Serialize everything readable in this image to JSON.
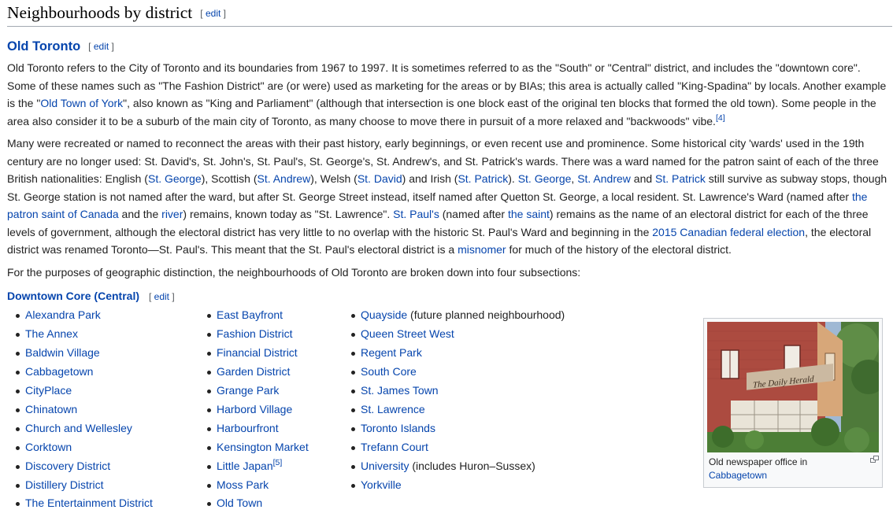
{
  "section": {
    "title": "Neighbourhoods by district",
    "edit_label": "edit"
  },
  "subsection": {
    "title": "Old Toronto",
    "edit_label": "edit"
  },
  "paragraphs": {
    "p1": [
      {
        "t": "Old Toronto refers to the City of Toronto and its boundaries from 1967 to 1997. It is sometimes referred to as the \"South\" or \"Central\" district, and includes the \"downtown core\". Some of these names such as \"The Fashion District\" are (or were) used as marketing for the areas or by BIAs; this area is actually called \"King-Spadina\" by locals. Another example is the \""
      },
      {
        "t": "Old Town of York",
        "link": true
      },
      {
        "t": "\", also known as \"King and Parliament\" (although that intersection is one block east of the original ten blocks that formed the old town). Some people in the area also consider it to be a suburb of the main city of Toronto, as many choose to move there in pursuit of a more relaxed and \"backwoods\" vibe."
      },
      {
        "t": "[4]",
        "link": true,
        "sup": true
      }
    ],
    "p2": [
      {
        "t": "Many were recreated or named to reconnect the areas with their past history, early beginnings, or even recent use and prominence. Some historical city 'wards' used in the 19th century are no longer used: St. David's, St. John's, St. Paul's, St. George's, St. Andrew's, and St. Patrick's wards. There was a ward named for the patron saint of each of the three British nationalities: English ("
      },
      {
        "t": "St. George",
        "link": true
      },
      {
        "t": "), Scottish ("
      },
      {
        "t": "St. Andrew",
        "link": true
      },
      {
        "t": "), Welsh ("
      },
      {
        "t": "St. David",
        "link": true
      },
      {
        "t": ") and Irish ("
      },
      {
        "t": "St. Patrick",
        "link": true
      },
      {
        "t": "). "
      },
      {
        "t": "St. George",
        "link": true
      },
      {
        "t": ", "
      },
      {
        "t": "St. Andrew",
        "link": true
      },
      {
        "t": " and "
      },
      {
        "t": "St. Patrick",
        "link": true
      },
      {
        "t": " still survive as subway stops, though St. George station is not named after the ward, but after St. George Street instead, itself named after Quetton St. George, a local resident. St. Lawrence's Ward (named after "
      },
      {
        "t": "the patron saint of Canada",
        "link": true
      },
      {
        "t": " and the "
      },
      {
        "t": "river",
        "link": true
      },
      {
        "t": ") remains, known today as \"St. Lawrence\". "
      },
      {
        "t": "St. Paul's",
        "link": true
      },
      {
        "t": " (named after "
      },
      {
        "t": "the saint",
        "link": true
      },
      {
        "t": ") remains as the name of an electoral district for each of the three levels of government, although the electoral district has very little to no overlap with the historic St. Paul's Ward and beginning in the "
      },
      {
        "t": "2015 Canadian federal election",
        "link": true
      },
      {
        "t": ", the electoral district was renamed Toronto—St. Paul's. This meant that the St. Paul's electoral district is a "
      },
      {
        "t": "misnomer",
        "link": true
      },
      {
        "t": " for much of the history of the electoral district."
      }
    ],
    "p3": [
      {
        "t": "For the purposes of geographic distinction, the neighbourhoods of Old Toronto are broken down into four subsections:"
      }
    ]
  },
  "subsubsection": {
    "title": "Downtown Core (Central)",
    "edit_label": "edit"
  },
  "columns": {
    "col1": [
      {
        "label": "Alexandra Park"
      },
      {
        "label": "The Annex"
      },
      {
        "label": "Baldwin Village"
      },
      {
        "label": "Cabbagetown"
      },
      {
        "label": "CityPlace"
      },
      {
        "label": "Chinatown"
      },
      {
        "label": "Church and Wellesley"
      },
      {
        "label": "Corktown"
      },
      {
        "label": "Discovery District"
      },
      {
        "label": "Distillery District"
      },
      {
        "label": "The Entertainment District"
      }
    ],
    "col2": [
      {
        "label": "East Bayfront"
      },
      {
        "label": "Fashion District"
      },
      {
        "label": "Financial District"
      },
      {
        "label": "Garden District"
      },
      {
        "label": "Grange Park"
      },
      {
        "label": "Harbord Village"
      },
      {
        "label": "Harbourfront"
      },
      {
        "label": "Kensington Market"
      },
      {
        "label": "Little Japan",
        "sup": "[5]"
      },
      {
        "label": "Moss Park"
      },
      {
        "label": "Old Town"
      }
    ],
    "col3": [
      {
        "label": "Quayside",
        "note": " (future planned neighbourhood)"
      },
      {
        "label": "Queen Street West"
      },
      {
        "label": "Regent Park"
      },
      {
        "label": "South Core"
      },
      {
        "label": "St. James Town"
      },
      {
        "label": "St. Lawrence"
      },
      {
        "label": "Toronto Islands"
      },
      {
        "label": "Trefann Court"
      },
      {
        "label": "University",
        "note": " (includes Huron–Sussex)"
      },
      {
        "label": "Yorkville"
      }
    ]
  },
  "thumbnail": {
    "caption_text": "Old newspaper office in",
    "caption_link": "Cabbagetown",
    "sign_text": "The Daily Herald"
  }
}
